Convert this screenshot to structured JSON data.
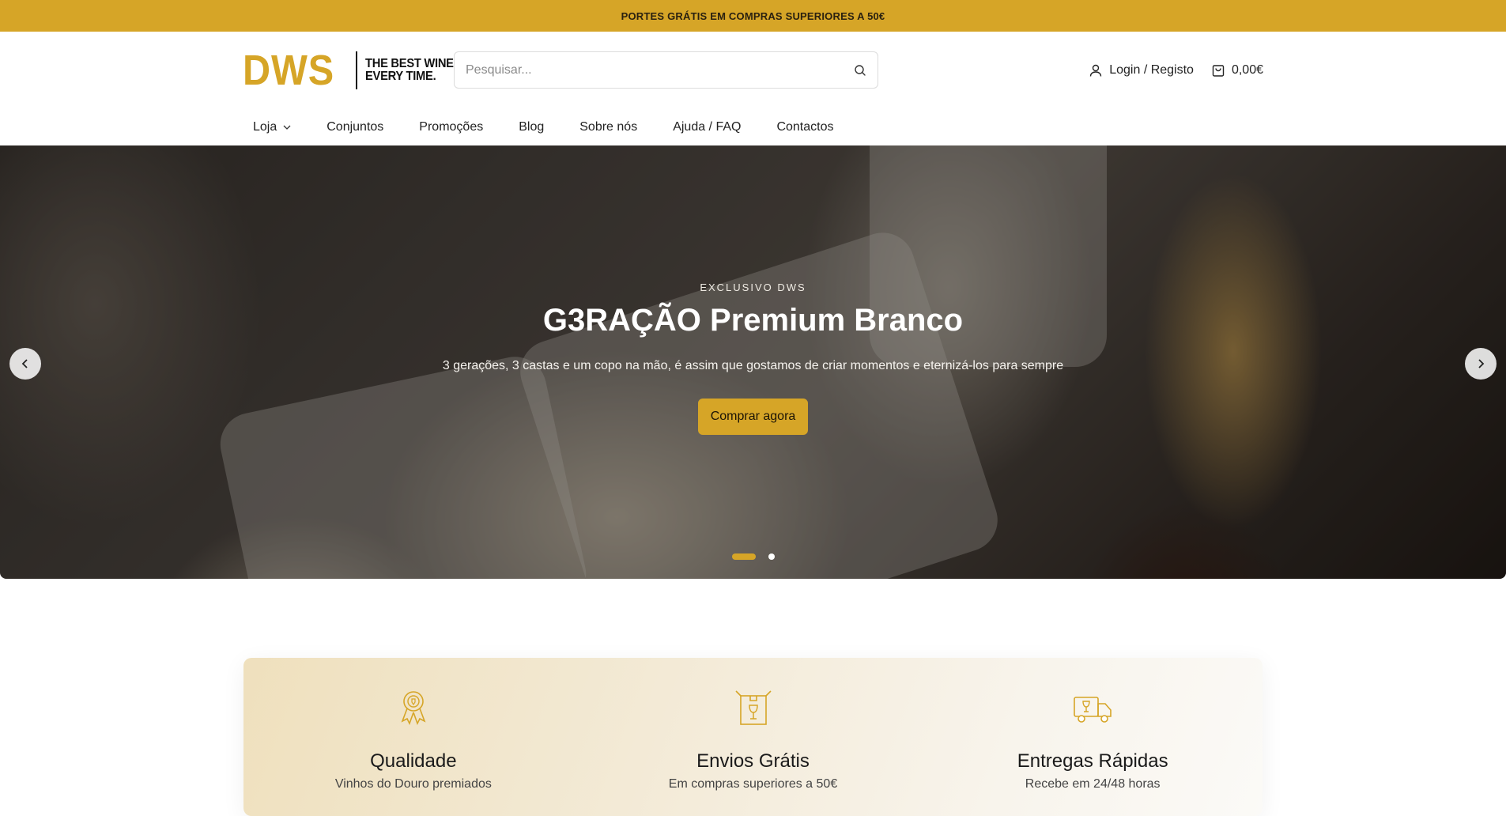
{
  "topbar": {
    "text": "PORTES GRÁTIS EM COMPRAS SUPERIORES A 50€"
  },
  "logo": {
    "mark": "DWS",
    "tagline_line1": "THE BEST WINE",
    "tagline_line2": "EVERY TIME."
  },
  "search": {
    "placeholder": "Pesquisar..."
  },
  "header": {
    "login": "Login / Registo",
    "cart_total": "0,00€"
  },
  "nav": {
    "items": [
      "Loja",
      "Conjuntos",
      "Promoções",
      "Blog",
      "Sobre nós",
      "Ajuda / FAQ",
      "Contactos"
    ]
  },
  "hero": {
    "eyebrow": "EXCLUSIVO DWS",
    "title": "G3RAÇÃO Premium Branco",
    "subtitle": "3 gerações, 3 castas e um copo na mão, é assim que gostamos de criar momentos e eternizá-los para sempre",
    "button": "Comprar agora",
    "slides": 2,
    "active_slide": 1
  },
  "features": [
    {
      "icon": "award-ribbon-icon",
      "title": "Qualidade",
      "desc": "Vinhos do Douro premiados"
    },
    {
      "icon": "wine-box-icon",
      "title": "Envios Grátis",
      "desc": "Em compras superiores a 50€"
    },
    {
      "icon": "delivery-truck-icon",
      "title": "Entregas Rápidas",
      "desc": "Recebe em 24/48 horas"
    }
  ],
  "colors": {
    "accent": "#d6a527",
    "text": "#1f1f1f"
  }
}
